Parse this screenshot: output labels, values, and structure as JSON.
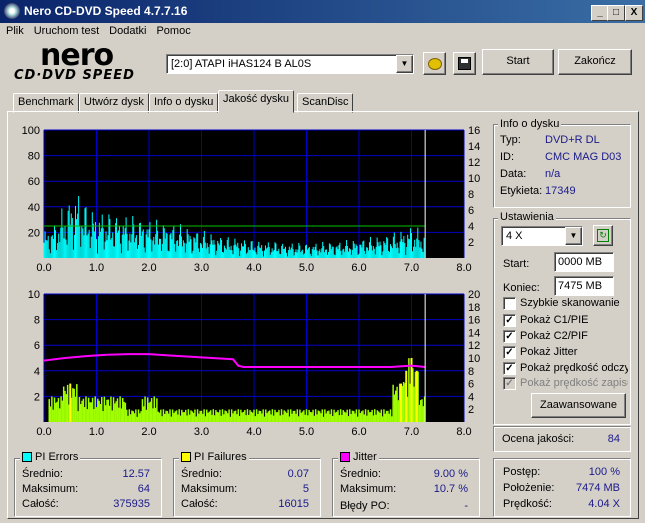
{
  "window": {
    "title": "Nero CD-DVD Speed 4.7.7.16",
    "min": "_",
    "max": "□",
    "close": "X"
  },
  "menu": [
    "Plik",
    "Uruchom test",
    "Dodatki",
    "Pomoc"
  ],
  "logo": {
    "brand": "nero",
    "product": "CD·DVD SPEED"
  },
  "drive": {
    "selected": "[2:0]   ATAPI iHAS124   B AL0S"
  },
  "buttons": {
    "start": "Start",
    "close": "Zakończ",
    "advanced": "Zaawansowane"
  },
  "tabs": [
    "Benchmark",
    "Utwórz dysk",
    "Info o dysku",
    "Jakość dysku",
    "ScanDisc"
  ],
  "active_tab": "Jakość dysku",
  "disc_info": {
    "title": "Info o dysku",
    "rows": [
      {
        "label": "Typ:",
        "value": "DVD+R DL"
      },
      {
        "label": "ID:",
        "value": "CMC MAG D03"
      },
      {
        "label": "Data:",
        "value": "n/a"
      },
      {
        "label": "Etykieta:",
        "value": "17349"
      }
    ]
  },
  "settings": {
    "title": "Ustawienia",
    "speed": "4 X",
    "start_label": "Start:",
    "start_value": "0000 MB",
    "end_label": "Koniec:",
    "end_value": "7475 MB",
    "checks": [
      {
        "label": "Szybkie skanowanie",
        "checked": false,
        "enabled": true
      },
      {
        "label": "Pokaż C1/PIE",
        "checked": true,
        "enabled": true
      },
      {
        "label": "Pokaż C2/PIF",
        "checked": true,
        "enabled": true
      },
      {
        "label": "Pokaż Jitter",
        "checked": true,
        "enabled": true
      },
      {
        "label": "Pokaż prędkość odczytu",
        "checked": true,
        "enabled": true
      },
      {
        "label": "Pokaż prędkość zapisu",
        "checked": true,
        "enabled": false
      }
    ]
  },
  "quality": {
    "label": "Ocena jakości:",
    "value": "84"
  },
  "pi_errors": {
    "title": "PI Errors",
    "color": "#00ffff",
    "avg_label": "Średnio:",
    "avg": "12.57",
    "max_label": "Maksimum:",
    "max": "64",
    "total_label": "Całość:",
    "total": "375935"
  },
  "pi_failures": {
    "title": "PI Failures",
    "color": "#ffff00",
    "avg_label": "Średnio:",
    "avg": "0.07",
    "max_label": "Maksimum:",
    "max": "5",
    "total_label": "Całość:",
    "total": "16015"
  },
  "jitter": {
    "title": "Jitter",
    "color": "#ff00ff",
    "avg_label": "Średnio:",
    "avg": "9.00 %",
    "max_label": "Maksimum:",
    "max": "10.7 %",
    "po_label": "Błędy PO:",
    "po": "-"
  },
  "progress": {
    "label": "Postęp:",
    "value": "100 %",
    "pos_label": "Położenie:",
    "pos": "7474 MB",
    "speed_label": "Prędkość:",
    "speed": "4.04 X"
  },
  "chart_data": [
    {
      "type": "area",
      "name": "PI Errors",
      "x_ticks": [
        "0.0",
        "1.0",
        "2.0",
        "3.0",
        "4.0",
        "5.0",
        "6.0",
        "7.0",
        "8.0"
      ],
      "y_ticks": [
        "20",
        "40",
        "60",
        "80",
        "100"
      ],
      "y2_ticks": [
        "2",
        "4",
        "6",
        "8",
        "10",
        "12",
        "14",
        "16"
      ],
      "xlim": [
        0,
        8
      ],
      "ylim": [
        0,
        100
      ],
      "y2lim": [
        0,
        16
      ],
      "series": [
        {
          "color": "#00ffff",
          "x": [
            0.0,
            0.1,
            0.2,
            0.3,
            0.4,
            0.5,
            0.6,
            0.7,
            0.8,
            0.9,
            1.0,
            1.2,
            1.4,
            1.6,
            1.8,
            2.0,
            2.2,
            2.4,
            2.6,
            2.8,
            3.0,
            3.2,
            3.4,
            3.6,
            3.8,
            4.0,
            4.2,
            4.4,
            4.6,
            4.8,
            5.0,
            5.2,
            5.4,
            5.6,
            5.8,
            6.0,
            6.2,
            6.4,
            6.6,
            6.8,
            7.0,
            7.1,
            7.2,
            7.26
          ],
          "y": [
            20,
            22,
            26,
            32,
            40,
            45,
            50,
            46,
            40,
            36,
            34,
            33,
            32,
            31,
            30,
            28,
            27,
            26,
            24,
            22,
            20,
            18,
            16,
            15,
            14,
            13,
            12,
            12,
            11,
            11,
            11,
            11,
            12,
            12,
            13,
            14,
            15,
            16,
            18,
            20,
            24,
            22,
            20,
            18
          ]
        },
        {
          "color": "#00c000",
          "x": [
            0.0,
            7.26
          ],
          "y": [
            4,
            4
          ]
        }
      ],
      "marker_x": 7.26
    },
    {
      "type": "bar",
      "name": "PI Failures / Jitter",
      "x_ticks": [
        "0.0",
        "1.0",
        "2.0",
        "3.0",
        "4.0",
        "5.0",
        "6.0",
        "7.0",
        "8.0"
      ],
      "y_ticks": [
        "2",
        "4",
        "6",
        "8",
        "10"
      ],
      "y2_ticks": [
        "2",
        "4",
        "6",
        "8",
        "10",
        "12",
        "14",
        "16",
        "18",
        "20"
      ],
      "xlim": [
        0,
        8
      ],
      "ylim": [
        0,
        10
      ],
      "y2lim": [
        0,
        20
      ],
      "series": [
        {
          "name": "PI Failures",
          "color": "#ffff00",
          "x": [
            0.2,
            0.5,
            0.8,
            1.1,
            1.4,
            1.7,
            2.0,
            2.3,
            2.6,
            2.9,
            3.2,
            3.5,
            3.8,
            4.1,
            4.4,
            4.7,
            5.0,
            5.3,
            5.6,
            5.9,
            6.2,
            6.5,
            6.8,
            6.9,
            7.0,
            7.1,
            7.2
          ],
          "y": [
            2,
            3,
            2,
            2,
            2,
            1,
            2,
            1,
            1,
            1,
            1,
            1,
            1,
            1,
            1,
            1,
            1,
            1,
            1,
            1,
            1,
            1,
            3,
            4,
            5,
            4,
            2
          ]
        },
        {
          "name": "Jitter",
          "color": "#ff00ff",
          "x": [
            0.0,
            0.4,
            0.8,
            1.2,
            1.6,
            2.0,
            2.4,
            2.8,
            3.2,
            3.6,
            3.7,
            3.8,
            4.2,
            4.6,
            5.0,
            5.4,
            5.8,
            6.2,
            6.6,
            7.0,
            7.26
          ],
          "y": [
            9.6,
            10.0,
            10.3,
            10.5,
            10.6,
            10.6,
            10.4,
            10.2,
            10.0,
            9.8,
            8.8,
            8.6,
            8.6,
            8.6,
            8.6,
            8.6,
            8.6,
            8.6,
            8.6,
            8.8,
            8.6
          ]
        }
      ],
      "marker_x": 7.26
    }
  ]
}
